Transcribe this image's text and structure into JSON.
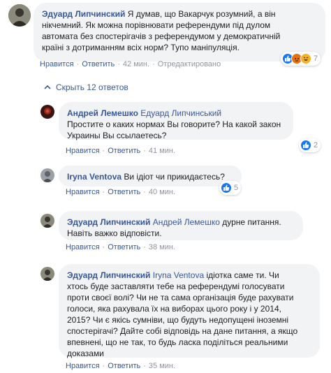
{
  "actions": {
    "like": "Нравится",
    "reply": "Ответить",
    "edited": "Отредактировано"
  },
  "separator": "·",
  "hide_replies": "Скрыть 12 ответов",
  "main_comment": {
    "author": "Эдуард Липчинский",
    "lines": [
      "Я думав, що Вакарчук розумний, а він",
      "нікчемний. Як можна порівнювати референдуми під дулом",
      "автомата без спостерігачів з референдумом у демократичній",
      "країні з дотриманням всіх норм? Тупо маніпуляція."
    ],
    "time": "42 мин.",
    "reactions": {
      "count": "7",
      "icons": [
        "like-icon",
        "angry-icon",
        "haha-icon"
      ]
    }
  },
  "replies": [
    {
      "author": "Андрей Лемешко",
      "mention": "Едуард Липчинський",
      "lines": [
        "Простите о каких нормах Вы говорите? На какой закон",
        "Украины Вы ссылаетесь?"
      ],
      "time": "41 мин.",
      "reactions": {
        "count": "2"
      }
    },
    {
      "author": "Iryna Ventova",
      "lines": [
        "Ви ідіот чи прикидаєтесь?"
      ],
      "time": "40 мин.",
      "reactions": {
        "count": "5"
      }
    },
    {
      "author": "Эдуард Липчинский",
      "mention": "Андрей Лемешко",
      "lines": [
        "дурне питання.",
        "Навіть важко відповісти."
      ],
      "time": "38 мин."
    },
    {
      "author": "Эдуард Липчинский",
      "mention": "Iryna Ventova",
      "lines": [
        "ідіотка саме ти. Чи",
        "хтось буде заставляти тебе на референдумі голосувати",
        "проти своєї волі? Чи не та сама організація буде рахувати",
        "голоси, яка рахувала їх на виборах цього року і у 2014,",
        "2015? Чи є якісь сумніви, що будуть недопущені іноземні",
        "спостерігачі? Дайте собі відповідь на дане питання, а якщо",
        "впевнені, що не так, то будь ласка поділіться реальними",
        "доказами"
      ],
      "time": "35 мин."
    }
  ]
}
